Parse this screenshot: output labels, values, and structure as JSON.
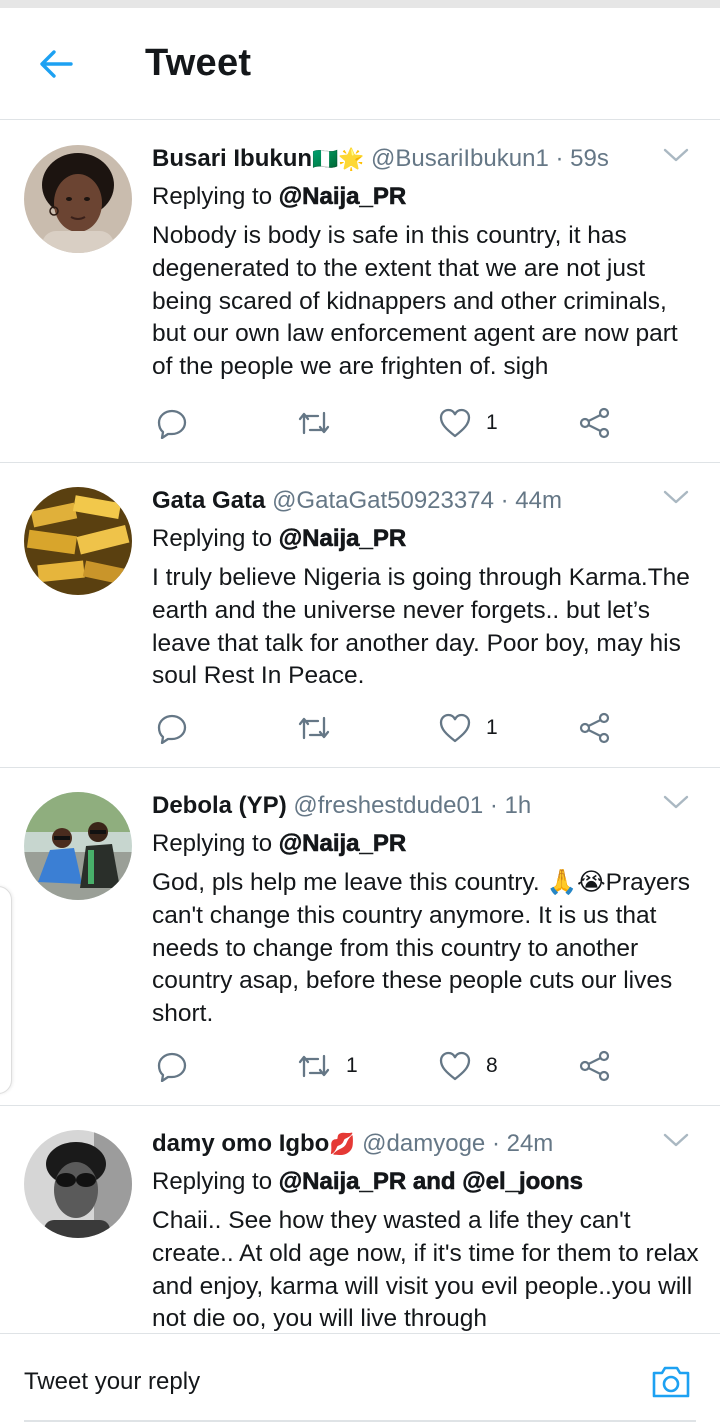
{
  "header": {
    "title": "Tweet"
  },
  "tweets": [
    {
      "display_name": "Busari Ibukun",
      "emoji": "🇳🇬🌟",
      "handle": "@BusariIbukun1",
      "separator": "·",
      "time": "59s",
      "replying_label": "Replying to",
      "mentions": "@Naija_PR",
      "text": "Nobody is body is safe in this country, it has degenerated to the extent that we are not just being scared of kidnappers and other criminals, but our own law enforcement agent are now part of the people we are frighten of. sigh",
      "retweets": "",
      "likes": "1"
    },
    {
      "display_name": "Gata Gata",
      "emoji": "",
      "handle": "@GataGat50923374",
      "separator": "·",
      "time": "44m",
      "replying_label": "Replying to",
      "mentions": "@Naija_PR",
      "text": "I truly believe Nigeria is going through Karma.The earth and the universe never forgets.. but let’s leave that talk for another day. Poor boy, may his soul Rest In Peace.",
      "retweets": "",
      "likes": "1"
    },
    {
      "display_name": "Debola (YP)",
      "emoji": "",
      "handle": "@freshestdude01",
      "separator": "·",
      "time": "1h",
      "replying_label": "Replying to",
      "mentions": "@Naija_PR",
      "text": "God, pls help me leave this country. 🙏😭Prayers can't change this country anymore. It is us that needs to change from this country to another country asap, before these people cuts our lives short.",
      "retweets": "1",
      "likes": "8"
    },
    {
      "display_name": "damy omo Igbo",
      "emoji": "💋",
      "handle": "@damyoge",
      "separator": "·",
      "time": "24m",
      "replying_label": "Replying to",
      "mentions": "@Naija_PR and @el_joons",
      "text": "Chaii.. See how they wasted a life they can't create.. At old age now, if it's time for them to relax and enjoy, karma will visit you evil people..you will not die oo, you will live through",
      "retweets": "",
      "likes": ""
    }
  ],
  "reply_bar": {
    "placeholder": "Tweet your reply"
  },
  "colors": {
    "accent": "#1da1f2",
    "icon_gray": "#657786",
    "divider": "#dfe3e6"
  },
  "icons": {
    "back": "arrow-left-icon",
    "reply": "reply-icon",
    "retweet": "retweet-icon",
    "like": "heart-icon",
    "share": "share-icon",
    "more": "chevron-down-icon",
    "camera": "camera-icon"
  }
}
